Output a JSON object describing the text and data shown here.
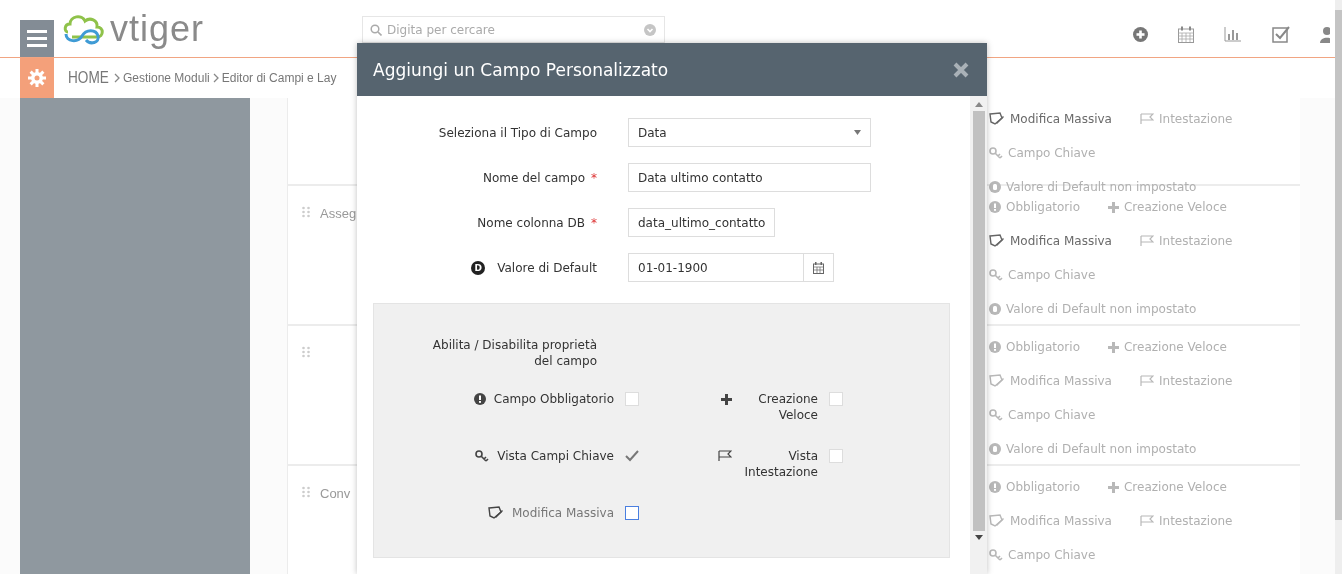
{
  "header": {
    "logo": "vtiger",
    "search": {
      "placeholder": "Digita per cercare"
    }
  },
  "breadcrumb": [
    "HOME",
    "Gestione Moduli",
    "Editor di Campi e Lay"
  ],
  "blocks": [
    {
      "rows": [
        [
          {
            "kind": "massedit",
            "text": "Modifica Massiva",
            "on": true
          },
          {
            "kind": "header",
            "text": "Intestazione",
            "on": false
          }
        ],
        [
          {
            "kind": "key",
            "text": "Campo Chiave",
            "on": false
          }
        ],
        [
          {
            "kind": "default",
            "text": "Valore di Default non impostato",
            "on": false
          }
        ]
      ]
    },
    {
      "label": "Asseg",
      "rows": [
        [
          {
            "kind": "mandatory",
            "text": "Obbligatorio",
            "on": false
          },
          {
            "kind": "quickcreate",
            "text": "Creazione Veloce",
            "on": false
          }
        ],
        [
          {
            "kind": "massedit",
            "text": "Modifica Massiva",
            "on": true
          },
          {
            "kind": "header",
            "text": "Intestazione",
            "on": false
          }
        ],
        [
          {
            "kind": "key",
            "text": "Campo Chiave",
            "on": false
          }
        ],
        [
          {
            "kind": "default",
            "text": "Valore di Default non impostato",
            "on": false
          }
        ]
      ]
    },
    {
      "rows": [
        [
          {
            "kind": "mandatory",
            "text": "Obbligatorio",
            "on": false
          },
          {
            "kind": "quickcreate",
            "text": "Creazione Veloce",
            "on": false
          }
        ],
        [
          {
            "kind": "massedit",
            "text": "Modifica Massiva",
            "on": false
          },
          {
            "kind": "header",
            "text": "Intestazione",
            "on": false
          }
        ],
        [
          {
            "kind": "key",
            "text": "Campo Chiave",
            "on": false
          }
        ],
        [
          {
            "kind": "default",
            "text": "Valore di Default non impostato",
            "on": false
          }
        ]
      ]
    },
    {
      "label": "Conv",
      "rows": [
        [
          {
            "kind": "mandatory",
            "text": "Obbligatorio",
            "on": false
          },
          {
            "kind": "quickcreate",
            "text": "Creazione Veloce",
            "on": false
          }
        ],
        [
          {
            "kind": "massedit",
            "text": "Modifica Massiva",
            "on": false
          },
          {
            "kind": "header",
            "text": "Intestazione",
            "on": false
          }
        ],
        [
          {
            "kind": "key",
            "text": "Campo Chiave",
            "on": false
          }
        ]
      ]
    }
  ],
  "modal": {
    "title": "Aggiungi un Campo Personalizzato",
    "fields": [
      {
        "kind": "select",
        "label": "Seleziona il Tipo di Campo",
        "value": "Data"
      },
      {
        "kind": "text",
        "label": "Nome del campo",
        "required_mark": "*",
        "value": "Data ultimo contatto"
      },
      {
        "kind": "short",
        "label": "Nome colonna DB",
        "required_mark": "*",
        "value": "data_ultimo_contatto"
      },
      {
        "kind": "date",
        "label": "Valore di Default",
        "badge": "D",
        "value": "01-01-1900"
      }
    ],
    "properties": {
      "heading": "Abilita / Disabilita proprietà del campo",
      "items": [
        {
          "kind": "mandatory",
          "label": "Campo Obbligatorio",
          "checked": false,
          "focused": false
        },
        {
          "kind": "quickcreate",
          "label": "Creazione Veloce",
          "checked": false,
          "focused": false
        },
        {
          "kind": "key",
          "label": "Vista Campi Chiave",
          "checked": true,
          "focused": false
        },
        {
          "kind": "header",
          "label": "Vista Intestazione",
          "checked": false,
          "focused": false
        },
        {
          "kind": "massedit",
          "label": "Modifica Massiva",
          "checked": false,
          "focused": true
        }
      ]
    }
  }
}
